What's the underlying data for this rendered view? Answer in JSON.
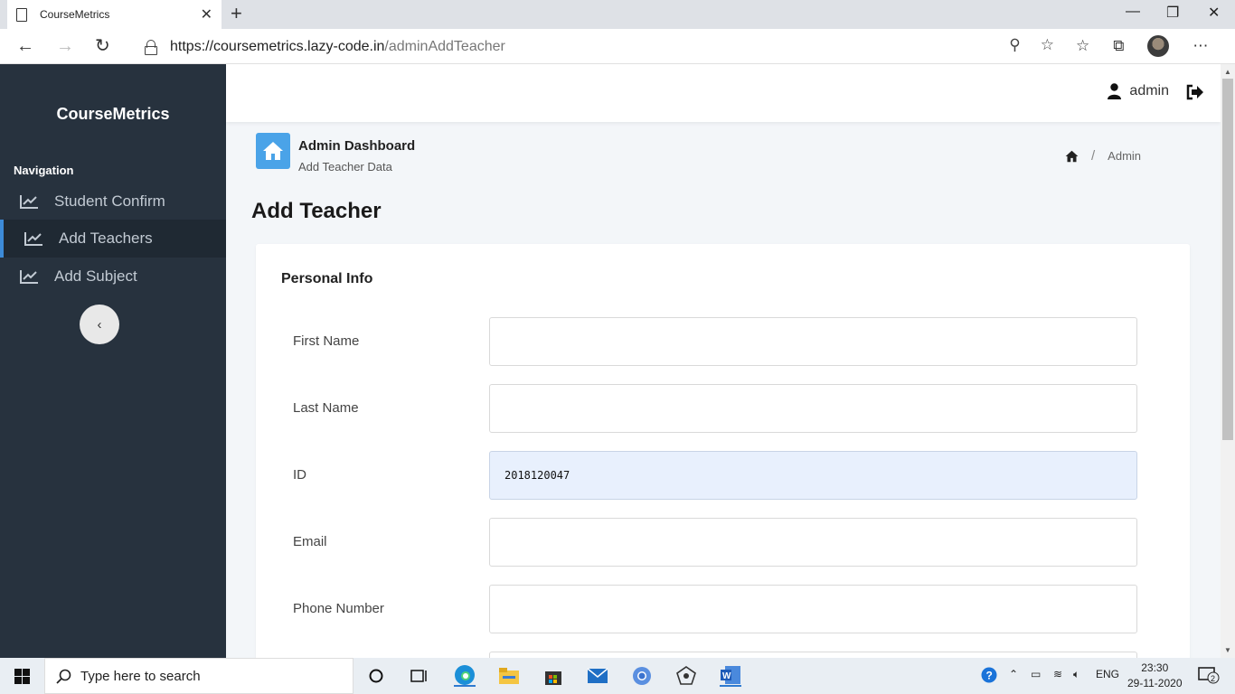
{
  "browser": {
    "tab_title": "CourseMetrics",
    "url_host": "https://coursemetrics.lazy-code.in",
    "url_path": "/adminAddTeacher"
  },
  "sidebar": {
    "brand": "CourseMetrics",
    "heading": "Navigation",
    "items": [
      {
        "label": "Student Confirm",
        "icon": "line-chart-icon",
        "active": false
      },
      {
        "label": "Add Teachers",
        "icon": "line-chart-icon",
        "active": true
      },
      {
        "label": "Add Subject",
        "icon": "line-chart-icon",
        "active": false
      }
    ]
  },
  "header": {
    "username": "admin"
  },
  "page_header": {
    "title": "Admin Dashboard",
    "subtitle": "Add Teacher Data",
    "breadcrumb_current": "Admin"
  },
  "page_title": "Add Teacher",
  "form": {
    "section_title": "Personal Info",
    "fields": [
      {
        "label": "First Name",
        "value": ""
      },
      {
        "label": "Last Name",
        "value": ""
      },
      {
        "label": "ID",
        "value": "2018120047"
      },
      {
        "label": "Email",
        "value": ""
      },
      {
        "label": "Phone Number",
        "value": ""
      }
    ]
  },
  "taskbar": {
    "search_placeholder": "Type here to search",
    "language": "ENG",
    "time": "23:30",
    "date": "29-11-2020",
    "notifications": "2"
  },
  "colors": {
    "sidebar_bg": "#27323e",
    "accent": "#3d8bd8",
    "home_tile": "#4aa3e8",
    "autofill_bg": "#e8f0fd"
  }
}
